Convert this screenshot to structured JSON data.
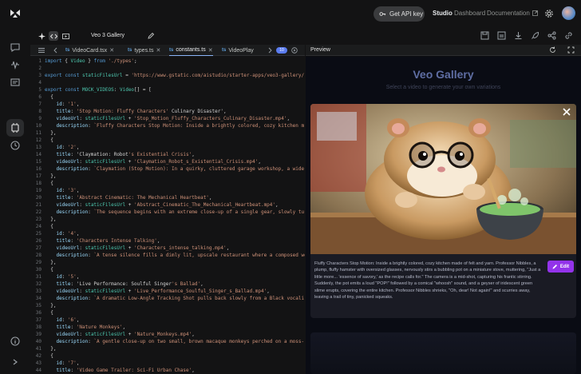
{
  "topbar": {
    "api_key_label": "Get API key",
    "nav_studio": "Studio",
    "nav_dashboard": "Dashboard",
    "nav_docs": "Documentation"
  },
  "editor": {
    "project_title": "Veo 3 Gallery",
    "tabs": [
      {
        "label": "VideoCard.tsx",
        "icon": "ts"
      },
      {
        "label": "types.ts",
        "icon": "ts"
      },
      {
        "label": "constants.ts",
        "icon": "ts"
      },
      {
        "label": "VideoPlay",
        "icon": "ts"
      }
    ],
    "badge": "10",
    "code_lines": [
      {
        "n": "1",
        "t": "import { Video } from './types';"
      },
      {
        "n": "2",
        "t": ""
      },
      {
        "n": "3",
        "t": "export const staticFilesUrl = 'https://www.gstatic.com/aistudio/starter-apps/veo3-gallery/';"
      },
      {
        "n": "4",
        "t": ""
      },
      {
        "n": "5",
        "t": "export const MOCK_VIDEOS: Video[] = ["
      },
      {
        "n": "6",
        "t": "  {"
      },
      {
        "n": "7",
        "t": "    id: '1',"
      },
      {
        "n": "8",
        "t": "    title: 'Stop Motion: Fluffy Characters' Culinary Disaster',"
      },
      {
        "n": "9",
        "t": "    videoUrl: staticFilesUrl + 'Stop_Motion_Fluffy_Characters_Culinary_Disaster.mp4',"
      },
      {
        "n": "10",
        "t": "    description: `Fluffy Characters Stop Motion: Inside a brightly colored, cozy kitchen m"
      },
      {
        "n": "11",
        "t": "  },"
      },
      {
        "n": "12",
        "t": "  {"
      },
      {
        "n": "13",
        "t": "    id: '2',"
      },
      {
        "n": "14",
        "t": "    title: 'Claymation: Robot's Existential Crisis',"
      },
      {
        "n": "15",
        "t": "    videoUrl: staticFilesUrl + 'Claymation_Robot_s_Existential_Crisis.mp4',"
      },
      {
        "n": "16",
        "t": "    description: `Claymation (Stop Motion): In a quirky, cluttered garage workshop, a wide"
      },
      {
        "n": "17",
        "t": "  },"
      },
      {
        "n": "18",
        "t": "  {"
      },
      {
        "n": "19",
        "t": "    id: '3',"
      },
      {
        "n": "20",
        "t": "    title: 'Abstract Cinematic: The Mechanical Heartbeat',"
      },
      {
        "n": "21",
        "t": "    videoUrl: staticFilesUrl + 'Abstract_Cinematic_The_Mechanical_Heartbeat.mp4',"
      },
      {
        "n": "22",
        "t": "    description: `The sequence begins with an extreme close-up of a single gear, slowly tu"
      },
      {
        "n": "23",
        "t": "  },"
      },
      {
        "n": "24",
        "t": "  {"
      },
      {
        "n": "25",
        "t": "    id: '4',"
      },
      {
        "n": "26",
        "t": "    title: 'Characters Intense Talking',"
      },
      {
        "n": "27",
        "t": "    videoUrl: staticFilesUrl + 'Characters_intense_talking.mp4',"
      },
      {
        "n": "28",
        "t": "    description: `A tense silence fills a dimly lit, upscale restaurant where a composed wo"
      },
      {
        "n": "29",
        "t": "  },"
      },
      {
        "n": "30",
        "t": "  {"
      },
      {
        "n": "31",
        "t": "    id: '5',"
      },
      {
        "n": "32",
        "t": "    title: 'Live Performance: Soulful Singer's Ballad',"
      },
      {
        "n": "33",
        "t": "    videoUrl: staticFilesUrl + 'Live_Performance_Soulful_Singer_s_Ballad.mp4',"
      },
      {
        "n": "34",
        "t": "    description: `A dramatic Low-Angle Tracking Shot pulls back slowly from a Black vocali"
      },
      {
        "n": "35",
        "t": "  },"
      },
      {
        "n": "36",
        "t": "  {"
      },
      {
        "n": "37",
        "t": "    id: '6',"
      },
      {
        "n": "38",
        "t": "    title: 'Nature Monkeys',"
      },
      {
        "n": "39",
        "t": "    videoUrl: staticFilesUrl + 'Nature_Monkeys.mp4',"
      },
      {
        "n": "40",
        "t": "    description: `A gentle close-up on two small, brown macaque monkeys perched on a moss-"
      },
      {
        "n": "41",
        "t": "  },"
      },
      {
        "n": "42",
        "t": "  {"
      },
      {
        "n": "43",
        "t": "    id: '7',"
      },
      {
        "n": "44",
        "t": "    title: 'Video Game Trailer: Sci-Fi Urban Chase',"
      }
    ]
  },
  "preview": {
    "title": "Preview",
    "app_title": "Veo Gallery",
    "app_subtitle": "Select a video to generate your own variations",
    "description": "Fluffy Characters Stop Motion: Inside a brightly colored, cozy kitchen made of felt and yarn. Professor Nibbles, a plump, fluffy hamster with oversized glasses, nervously stirs a bubbling pot on a miniature stove, muttering, \"Just a little more... 'essence of savory,' as the recipe calls for.\" The camera is a mid-shot, capturing his frantic stirring. Suddenly, the pot emits a loud \"POP!\" followed by a comical \"whoosh\" sound, and a geyser of iridescent green slime erupts, covering the entire kitchen. Professor Nibbles shrieks, \"Oh, dear! Not again!\" and scurries away, leaving a trail of tiny, panicked squeaks.",
    "edit_label": "Edit"
  },
  "colors": {
    "accent_purple": "#9333ea",
    "app_title": "#5f6ea3",
    "link_blue": "#8ab4f8"
  }
}
